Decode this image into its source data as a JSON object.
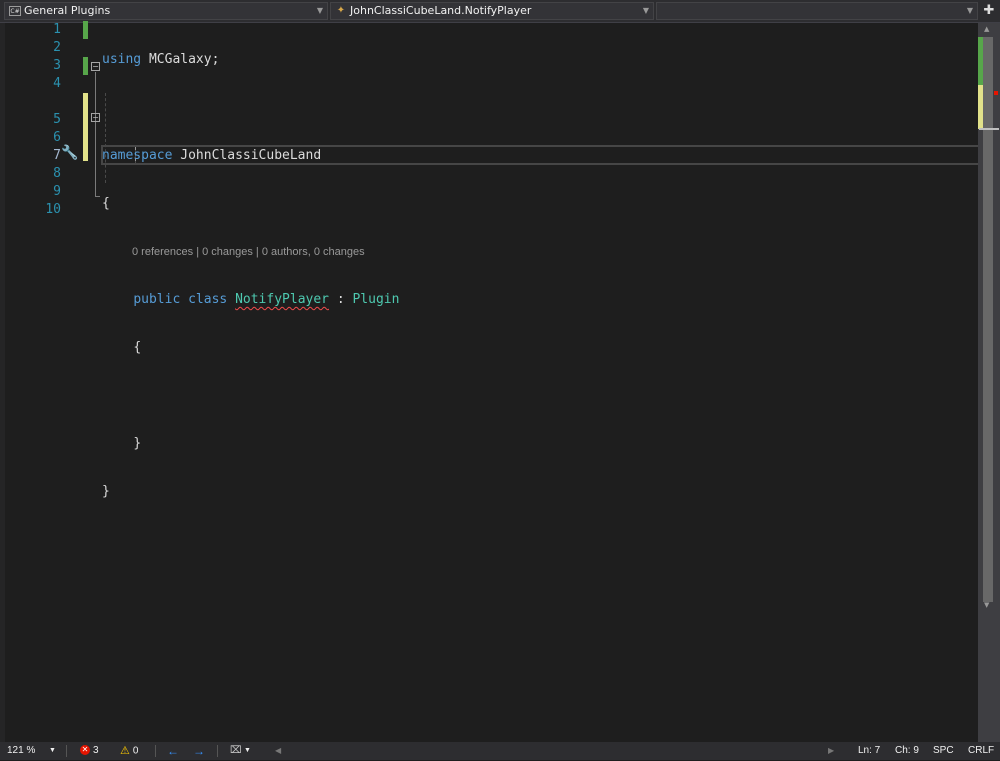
{
  "navbar": {
    "project": {
      "icon": "csharp-project-icon",
      "label": "General Plugins"
    },
    "type": {
      "icon": "class-icon",
      "label": "JohnClassiCubeLand.NotifyPlayer"
    },
    "member": {
      "label": ""
    },
    "split_icon": "split-window-icon"
  },
  "gutter": {
    "line_numbers": [
      "1",
      "2",
      "3",
      "4",
      "5",
      "6",
      "7",
      "8",
      "9",
      "10"
    ]
  },
  "code": {
    "line1": {
      "kw": "using",
      "rest": " MCGalaxy;"
    },
    "line3": {
      "kw": "namespace",
      "rest": " JohnClassiCubeLand"
    },
    "line4": "{",
    "codelens": "0 references | 0 changes | 0 authors, 0 changes",
    "line5": {
      "kw1": "public",
      "kw2": "class",
      "name": "NotifyPlayer",
      "sep": " : ",
      "base": "Plugin"
    },
    "line6": "{",
    "line8": "}",
    "line9": "}"
  },
  "colors": {
    "keyword": "#569cd6",
    "type": "#4ec9b0",
    "line_number": "#2b91af",
    "saved_change": "#57a64a",
    "unsaved_change": "#e2e28a",
    "error": "#e51400"
  },
  "status": {
    "zoom": "121 %",
    "errors": "3",
    "warnings": "0",
    "line": "Ln: 7",
    "char": "Ch: 9",
    "whitespace": "SPC",
    "line_ending": "CRLF"
  }
}
